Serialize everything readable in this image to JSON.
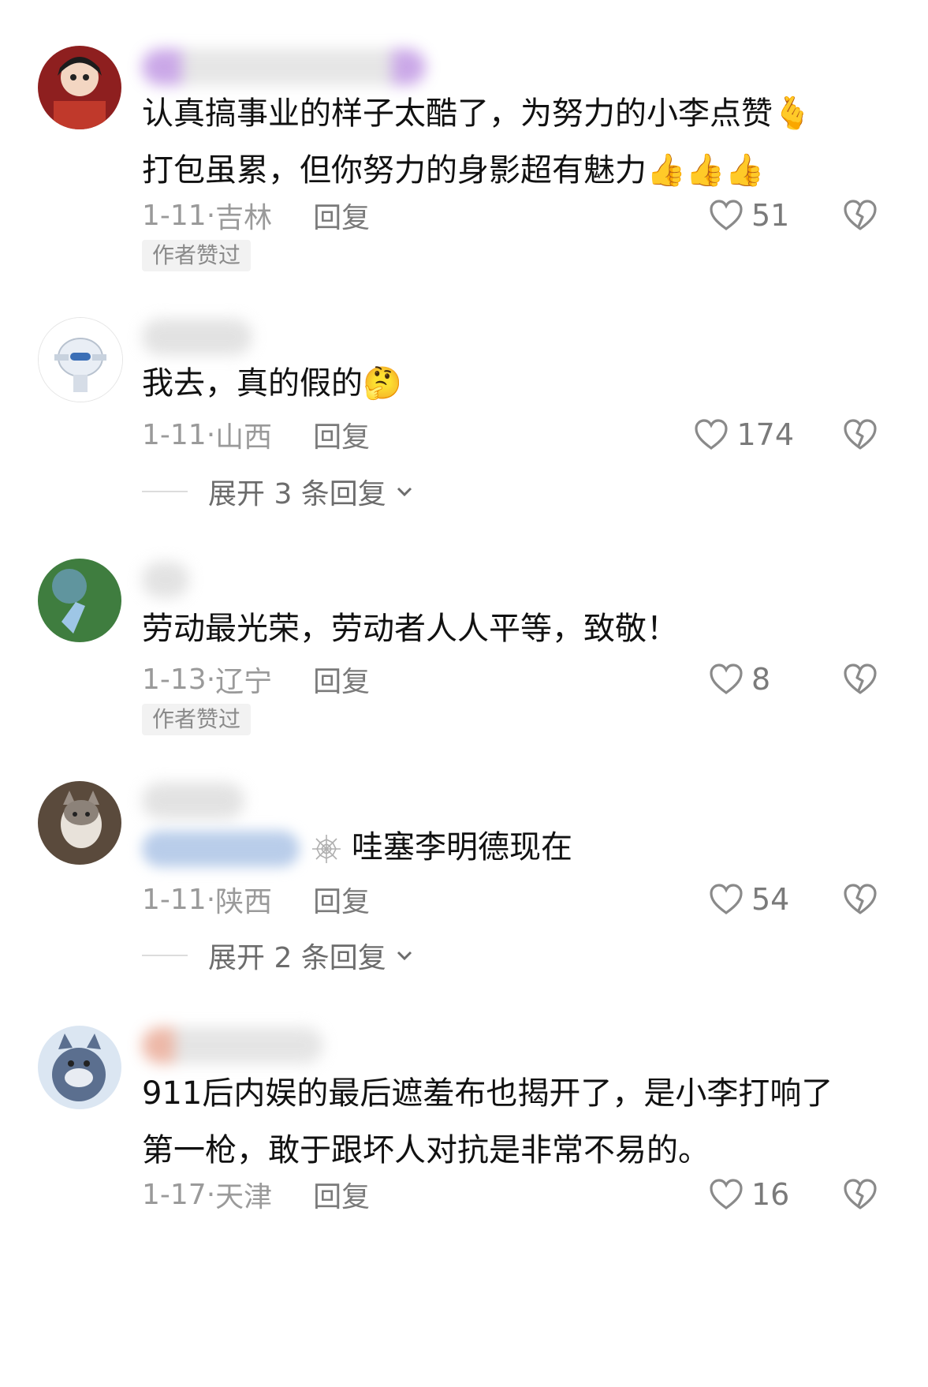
{
  "comments": [
    {
      "text_lines": [
        "认真搞事业的样子太酷了，为努力的小李点赞",
        "打包虽累，但你努力的身影超有魅力"
      ],
      "line1_emoji": "🫰",
      "line2_emoji": "👍👍👍",
      "date": "1-11",
      "location": "吉林",
      "reply_label": "回复",
      "likes": "51",
      "author_badge": "作者赞过",
      "avatar_color": "#c0392b"
    },
    {
      "text": "我去，真的假的",
      "emoji": "🤔",
      "date": "1-11",
      "location": "山西",
      "reply_label": "回复",
      "likes": "174",
      "expand_label": "展开 3 条回复",
      "avatar_color": "#dfe8f2"
    },
    {
      "text": "劳动最光荣，劳动者人人平等，致敬！",
      "date": "1-13",
      "location": "辽宁",
      "reply_label": "回复",
      "likes": "8",
      "author_badge": "作者赞过",
      "avatar_color": "#3f7d3f"
    },
    {
      "text": "哇塞李明德现在",
      "date": "1-11",
      "location": "陕西",
      "reply_label": "回复",
      "likes": "54",
      "expand_label": "展开 2 条回复",
      "avatar_color": "#6b5a4a"
    },
    {
      "text_lines": [
        "911后内娱的最后遮羞布也揭开了，是小李打响了",
        "第一枪，敢于跟坏人对抗是非常不易的。"
      ],
      "date": "1-17",
      "location": "天津",
      "reply_label": "回复",
      "likes": "16",
      "avatar_color": "#4b7bbd"
    }
  ],
  "separator": "·",
  "icons": {
    "like": "heart-outline-icon",
    "dislike": "broken-heart-icon",
    "expand": "chevron-down-icon"
  }
}
